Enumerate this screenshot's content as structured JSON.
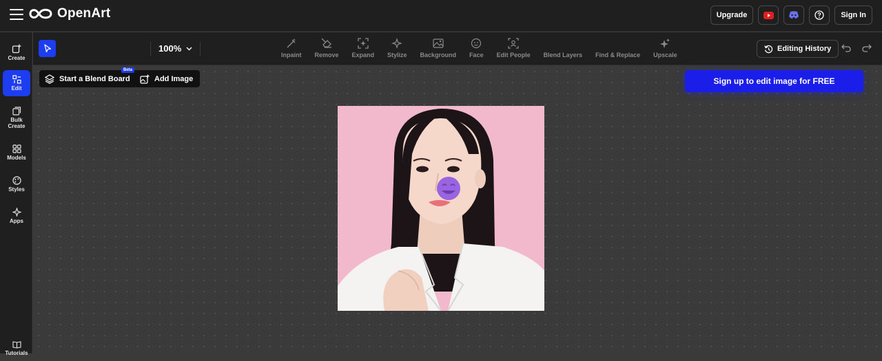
{
  "header": {
    "logo_text": "OpenArt",
    "upgrade_label": "Upgrade",
    "sign_in_label": "Sign In",
    "icons": [
      "menu-icon",
      "youtube-icon",
      "discord-icon",
      "help-icon"
    ]
  },
  "sidebar": {
    "items": [
      {
        "label": "Create",
        "icon": "create-icon"
      },
      {
        "label": "Edit",
        "icon": "edit-icon",
        "active": true
      },
      {
        "label": "Bulk Create",
        "icon": "bulk-create-icon"
      },
      {
        "label": "Models",
        "icon": "models-icon"
      },
      {
        "label": "Styles",
        "icon": "styles-icon"
      },
      {
        "label": "Apps",
        "icon": "apps-icon"
      },
      {
        "label": "Tutorials",
        "icon": "tutorials-icon"
      }
    ]
  },
  "toolbar": {
    "zoom": "100%",
    "tools": [
      {
        "label": "Inpaint"
      },
      {
        "label": "Remove"
      },
      {
        "label": "Expand"
      },
      {
        "label": "Stylize"
      },
      {
        "label": "Background"
      },
      {
        "label": "Face"
      },
      {
        "label": "Edit People"
      },
      {
        "label": "Blend Layers"
      },
      {
        "label": "Find & Replace"
      },
      {
        "label": "Upscale"
      }
    ],
    "history_label": "Editing History"
  },
  "canvas": {
    "blend_board_label": "Start a Blend Board",
    "beta_badge": "Beta",
    "add_image_label": "Add Image",
    "signup_label": "Sign up to edit image for FREE"
  },
  "colors": {
    "accent": "#1d3df0",
    "signup": "#1a1ee8",
    "background": "#3a3a3a",
    "panel": "#1f1f1f"
  }
}
